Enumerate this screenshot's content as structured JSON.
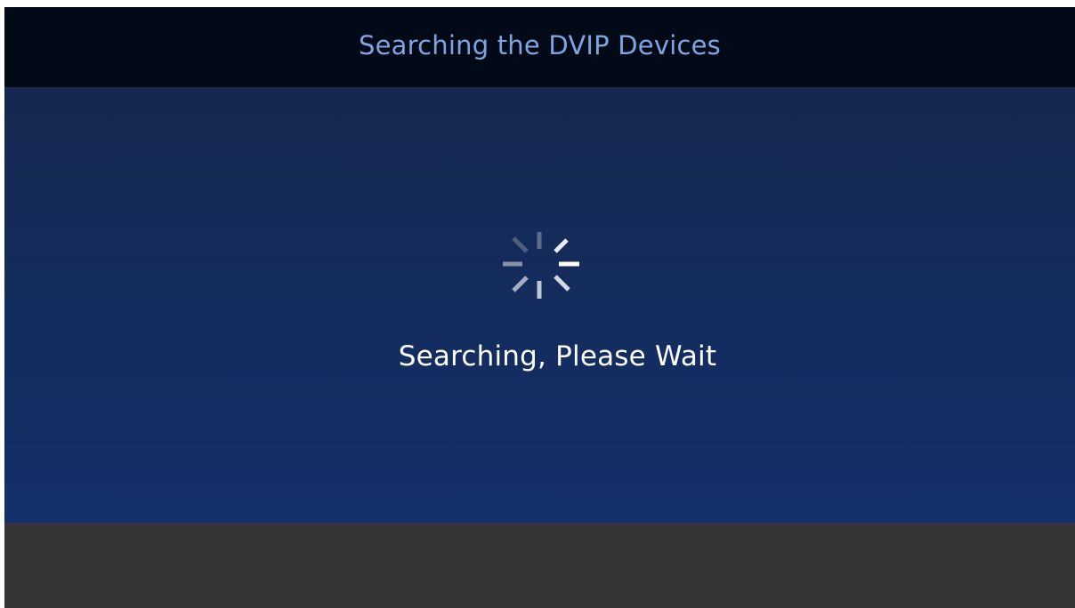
{
  "header": {
    "title": "Searching the DVIP Devices"
  },
  "main": {
    "status_text": "Searching, Please Wait",
    "spinner_icon": "loading-spinner-icon"
  },
  "colors": {
    "header_bg": "#020a18",
    "header_text": "#7ea4e2",
    "main_bg_top": "#152850",
    "main_bg_bottom": "#14306a",
    "footer_bg": "#353535",
    "status_text": "#ffffff"
  }
}
